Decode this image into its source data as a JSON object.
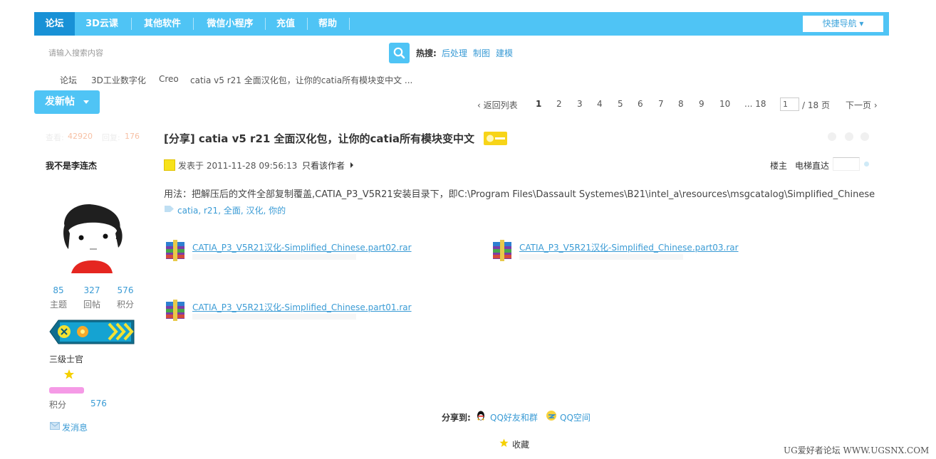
{
  "nav": {
    "items": [
      {
        "label": "论坛",
        "active": true
      },
      {
        "label": "3D云课"
      },
      {
        "label": "其他软件"
      },
      {
        "label": "微信小程序"
      },
      {
        "label": "充值"
      },
      {
        "label": "帮助"
      }
    ],
    "quick_nav": "快捷导航"
  },
  "search": {
    "placeholder": "请输入搜索内容",
    "hot_label": "热搜:",
    "hot_links": [
      "后处理",
      "制图",
      "建模"
    ]
  },
  "breadcrumb": [
    "论坛",
    "3D工业数字化",
    "Creo",
    "catia v5 r21 全面汉化包，让你的catia所有模块变中文 ..."
  ],
  "new_post_label": "发新帖",
  "pager": {
    "back": "‹ 返回列表",
    "pages": [
      "1",
      "2",
      "3",
      "4",
      "5",
      "6",
      "7",
      "8",
      "9",
      "10",
      "... 18"
    ],
    "current": "1",
    "input_value": "1",
    "total": "/ 18 页",
    "next": "下一页 ›"
  },
  "author": {
    "ghost_stats": [
      "查看:",
      "42920",
      "回复:",
      "176"
    ],
    "username": "我不是李连杰",
    "stats": [
      {
        "value": "85",
        "label": "主题"
      },
      {
        "value": "327",
        "label": "回帖"
      },
      {
        "value": "576",
        "label": "积分"
      }
    ],
    "rank": "三级士官",
    "score_label": "积分",
    "score_value": "576",
    "message_label": "发消息"
  },
  "post": {
    "title": "[分享] catia v5 r21 全面汉化包，让你的catia所有模块变中文",
    "date": "发表于 2011-11-28 09:56:13",
    "only_author": "只看该作者",
    "floor": "楼主",
    "jump_label": "电梯直达",
    "body": "用法：把解压后的文件全部复制覆盖,CATIA_P3_V5R21安装目录下，即C:\\Program Files\\Dassault Systemes\\B21\\intel_a\\resources\\msgcatalog\\Simplified_Chinese",
    "tags": [
      "catia",
      "r21",
      "全面",
      "汉化",
      "你的"
    ],
    "attachments": [
      "CATIA_P3_V5R21汉化-Simplified_Chinese.part02.rar",
      "CATIA_P3_V5R21汉化-Simplified_Chinese.part03.rar",
      "CATIA_P3_V5R21汉化-Simplified_Chinese.part01.rar"
    ],
    "share_label": "分享到:",
    "share_qq": "QQ好友和群",
    "share_qzone": "QQ空间",
    "favorite": "收藏"
  },
  "watermark": "UG爱好者论坛 WWW.UGSNX.COM",
  "colors": {
    "accent": "#4fc4f5",
    "active_nav": "#1891d6",
    "link": "#3a9bd5"
  }
}
